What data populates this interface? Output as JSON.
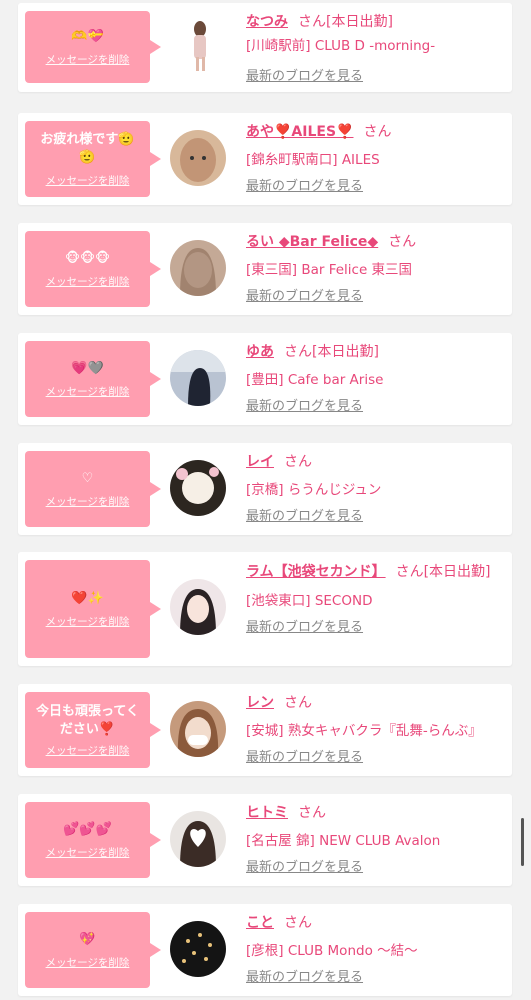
{
  "cards": [
    {
      "message": "🫶💝",
      "delete_label": "メッセージを削除",
      "name": "なつみ",
      "san": "さん",
      "status": "[本日出勤]",
      "store": "[川崎駅前] CLUB D -morning-",
      "blog_link": "最新のブログを見る"
    },
    {
      "message": "お疲れ様です🫡🫡",
      "delete_label": "メッセージを削除",
      "name": "あや❣️AILES❣️",
      "san": "さん",
      "status": "",
      "store": "[錦糸町駅南口] AILES",
      "blog_link": "最新のブログを見る"
    },
    {
      "message": "🐵🐵🐵",
      "delete_label": "メッセージを削除",
      "name": "るい ◆Bar Felice◆",
      "san": "さん",
      "status": "",
      "store": "[東三国] Bar Felice 東三国",
      "blog_link": "最新のブログを見る"
    },
    {
      "message": "💗🩶",
      "delete_label": "メッセージを削除",
      "name": "ゆあ",
      "san": "さん",
      "status": "[本日出勤]",
      "store": "[豊田] Cafe bar Arise",
      "blog_link": "最新のブログを見る"
    },
    {
      "message": "♡",
      "delete_label": "メッセージを削除",
      "name": "レイ",
      "san": "さん",
      "status": "",
      "store": "[京橋] らうんじジュン",
      "blog_link": "最新のブログを見る"
    },
    {
      "message": "❤️✨",
      "delete_label": "メッセージを削除",
      "name": "ラム【池袋セカンド】",
      "san": "さん",
      "status": "[本日出勤]",
      "store": "[池袋東口] SECOND",
      "blog_link": "最新のブログを見る"
    },
    {
      "message": "今日も頑張ってください❣️",
      "delete_label": "メッセージを削除",
      "name": "レン",
      "san": "さん",
      "status": "",
      "store": "[安城] 熟女キャバクラ『乱舞-らんぶ』",
      "blog_link": "最新のブログを見る"
    },
    {
      "message": "💕💕💕",
      "delete_label": "メッセージを削除",
      "name": "ヒトミ",
      "san": "さん",
      "status": "",
      "store": "[名古屋 錦] NEW CLUB Avalon",
      "blog_link": "最新のブログを見る"
    },
    {
      "message": "💖",
      "delete_label": "メッセージを削除",
      "name": "こと",
      "san": "さん",
      "status": "",
      "store": "[彦根] CLUB Mondo 〜結〜",
      "blog_link": "最新のブログを見る"
    }
  ],
  "colors": {
    "accent": "#e8487a",
    "bubble": "#ff9eb0",
    "link_gray": "#888888",
    "background": "#f2f2f2"
  },
  "icons": [
    "avatar-photo"
  ]
}
